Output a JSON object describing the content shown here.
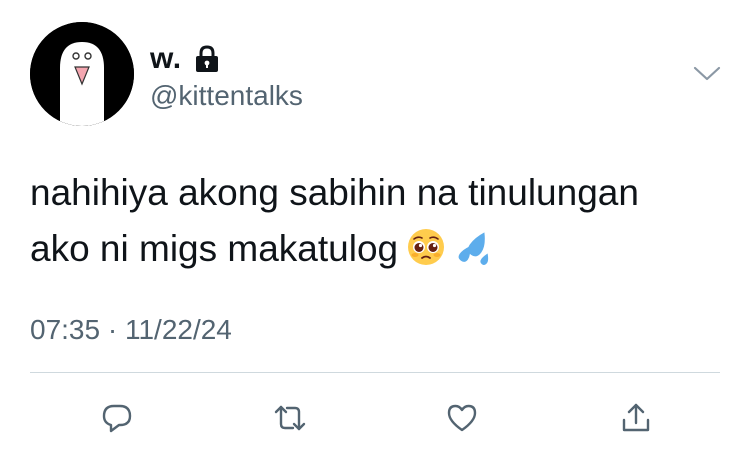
{
  "author": {
    "display_name": "w.",
    "handle": "@kittentalks",
    "avatar_icon": "ghost-avatar-icon",
    "protected_icon": "lock-icon"
  },
  "menu": {
    "icon": "chevron-down-icon"
  },
  "tweet": {
    "text_line_1": "nahihiya akong sabihin na tinulungan",
    "text_line_2": "ako ni migs makatulog",
    "emojis": [
      "pleading-face-emoji",
      "sweat-droplets-emoji"
    ]
  },
  "meta": {
    "time": "07:35",
    "separator": "·",
    "date": "11/22/24"
  },
  "actions": [
    {
      "name": "reply",
      "icon": "reply-icon"
    },
    {
      "name": "retweet",
      "icon": "retweet-icon"
    },
    {
      "name": "like",
      "icon": "heart-icon"
    },
    {
      "name": "share",
      "icon": "share-icon"
    }
  ],
  "colors": {
    "text": "#0f1419",
    "secondary": "#536471",
    "divider": "#cfd9de",
    "icon": "#536471"
  }
}
